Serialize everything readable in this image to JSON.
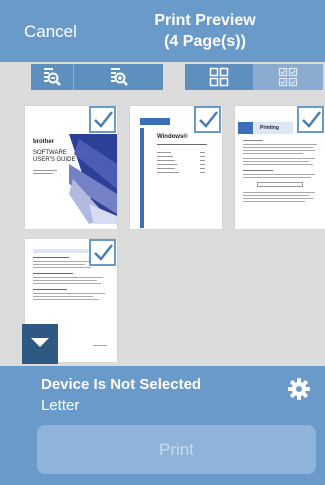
{
  "navbar": {
    "cancel_label": "Cancel",
    "title_line1": "Print Preview",
    "title_line2": "(4 Page(s))"
  },
  "toolbar": {
    "icons": [
      "zoom-out-icon",
      "zoom-in-icon",
      "grid-view-icon",
      "select-all-check-icon"
    ]
  },
  "pages": [
    {
      "id": 1,
      "selected": true,
      "brand": "brother",
      "title_line1": "SOFTWARE",
      "title_line2": "USER'S GUIDE"
    },
    {
      "id": 2,
      "selected": true,
      "heading": "Windows®"
    },
    {
      "id": 3,
      "selected": true,
      "heading": "Printing"
    },
    {
      "id": 4,
      "selected": true,
      "heading": ""
    }
  ],
  "bottom": {
    "device_status": "Device Is Not Selected",
    "paper_size": "Letter",
    "print_label": "Print"
  },
  "colors": {
    "accent": "#6a9ac9",
    "accent_dark": "#2f5883",
    "background": "#dcdcdc"
  }
}
